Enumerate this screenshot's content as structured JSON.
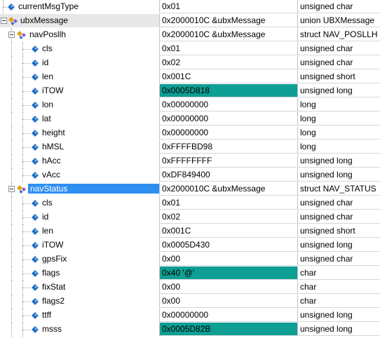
{
  "watch": {
    "rows": [
      {
        "name": "currentMsgType",
        "value": "0x01",
        "type": "unsigned char",
        "level": 0,
        "icon": "field-icon",
        "toggle": "none"
      },
      {
        "name": "ubxMessage",
        "value": "0x2000010C &ubxMessage",
        "type": "union UBXMessage",
        "level": 0,
        "icon": "struct-icon",
        "toggle": "expanded",
        "name_bg": "#e8e8e8"
      },
      {
        "name": "navPosllh",
        "value": "0x2000010C &ubxMessage",
        "type": "struct NAV_POSLLH",
        "level": 1,
        "icon": "struct-icon",
        "toggle": "expanded"
      },
      {
        "name": "cls",
        "value": "0x01",
        "type": "unsigned char",
        "level": 2,
        "icon": "field-icon"
      },
      {
        "name": "id",
        "value": "0x02",
        "type": "unsigned char",
        "level": 2,
        "icon": "field-icon"
      },
      {
        "name": "len",
        "value": "0x001C",
        "type": "unsigned short",
        "level": 2,
        "icon": "field-icon"
      },
      {
        "name": "iTOW",
        "value": "0x0005D818",
        "type": "unsigned long",
        "level": 2,
        "icon": "field-icon",
        "highlight": true
      },
      {
        "name": "lon",
        "value": "0x00000000",
        "type": "long",
        "level": 2,
        "icon": "field-icon"
      },
      {
        "name": "lat",
        "value": "0x00000000",
        "type": "long",
        "level": 2,
        "icon": "field-icon"
      },
      {
        "name": "height",
        "value": "0x00000000",
        "type": "long",
        "level": 2,
        "icon": "field-icon"
      },
      {
        "name": "hMSL",
        "value": "0xFFFFBD98",
        "type": "long",
        "level": 2,
        "icon": "field-icon"
      },
      {
        "name": "hAcc",
        "value": "0xFFFFFFFF",
        "type": "unsigned long",
        "level": 2,
        "icon": "field-icon"
      },
      {
        "name": "vAcc",
        "value": "0xDF849400",
        "type": "unsigned long",
        "level": 2,
        "icon": "field-icon"
      },
      {
        "name": "navStatus",
        "value": "0x2000010C &ubxMessage",
        "type": "struct NAV_STATUS",
        "level": 1,
        "icon": "struct-icon",
        "toggle": "expanded",
        "selected": true
      },
      {
        "name": "cls",
        "value": "0x01",
        "type": "unsigned char",
        "level": 2,
        "icon": "field-icon"
      },
      {
        "name": "id",
        "value": "0x02",
        "type": "unsigned char",
        "level": 2,
        "icon": "field-icon"
      },
      {
        "name": "len",
        "value": "0x001C",
        "type": "unsigned short",
        "level": 2,
        "icon": "field-icon"
      },
      {
        "name": "iTOW",
        "value": "0x0005D430",
        "type": "unsigned long",
        "level": 2,
        "icon": "field-icon"
      },
      {
        "name": "gpsFix",
        "value": "0x00",
        "type": "unsigned char",
        "level": 2,
        "icon": "field-icon"
      },
      {
        "name": "flags",
        "value": "0x40 '@'",
        "type": "char",
        "level": 2,
        "icon": "field-icon",
        "highlight": true
      },
      {
        "name": "fixStat",
        "value": "0x00",
        "type": "char",
        "level": 2,
        "icon": "field-icon"
      },
      {
        "name": "flags2",
        "value": "0x00",
        "type": "char",
        "level": 2,
        "icon": "field-icon"
      },
      {
        "name": "ttff",
        "value": "0x00000000",
        "type": "unsigned long",
        "level": 2,
        "icon": "field-icon"
      },
      {
        "name": "msss",
        "value": "0x0005D82B",
        "type": "unsigned long",
        "level": 2,
        "icon": "field-icon",
        "highlight": true
      }
    ]
  },
  "colors": {
    "changed_value_bg": "#0e9e93",
    "selection_bg": "#2f8ff0",
    "field_icon": "#2470c7",
    "struct_icon_main": "#e0a21a",
    "struct_icon_sub": "#8a5cc7"
  }
}
